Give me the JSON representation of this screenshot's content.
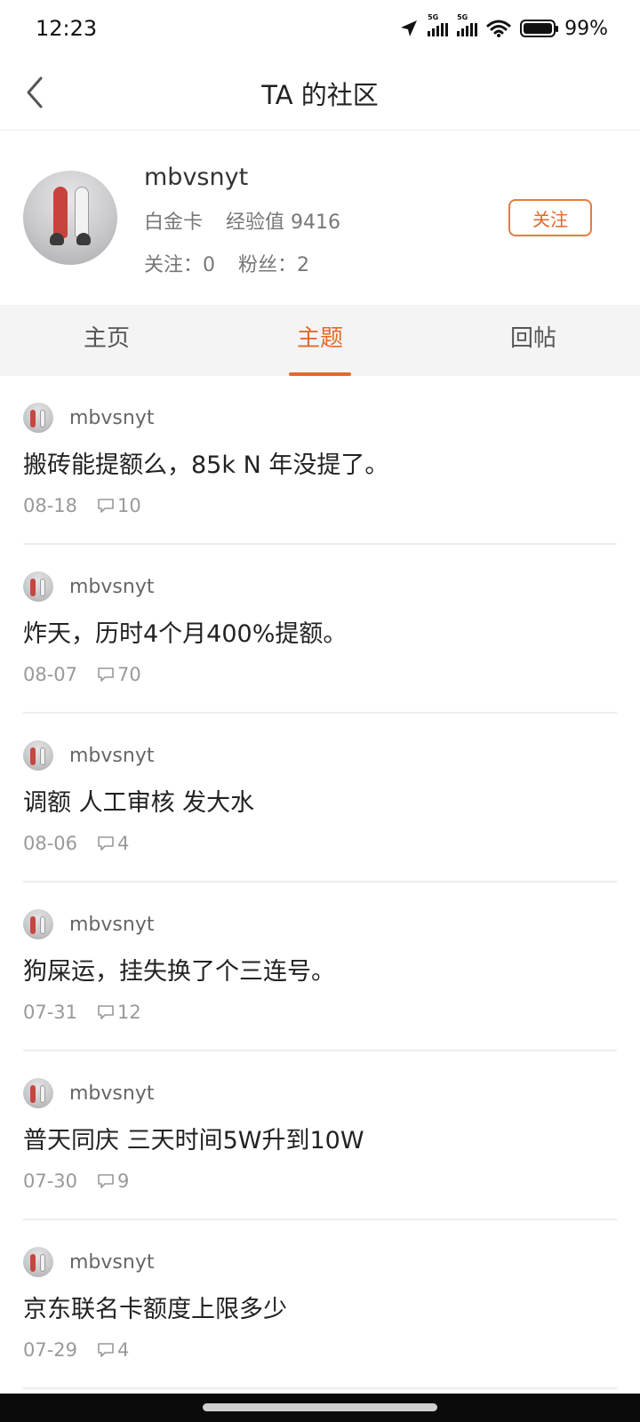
{
  "status": {
    "time": "12:23",
    "battery": "99%",
    "network1": "5G",
    "network2": "5G"
  },
  "nav": {
    "title": "TA 的社区"
  },
  "profile": {
    "username": "mbvsnyt",
    "card_level": "白金卡",
    "experience": "经验值 9416",
    "following": "关注：0",
    "followers": "粉丝：2",
    "follow_button": "关注"
  },
  "tabs": [
    {
      "label": "主页",
      "active": false
    },
    {
      "label": "主题",
      "active": true
    },
    {
      "label": "回帖",
      "active": false
    }
  ],
  "posts": [
    {
      "author": "mbvsnyt",
      "title": "搬砖能提额么，85k N 年没提了。",
      "date": "08-18",
      "comments": "10"
    },
    {
      "author": "mbvsnyt",
      "title": "炸天，历时4个月400%提额。",
      "date": "08-07",
      "comments": "70"
    },
    {
      "author": "mbvsnyt",
      "title": "调额 人工审核 发大水",
      "date": "08-06",
      "comments": "4"
    },
    {
      "author": "mbvsnyt",
      "title": "狗屎运，挂失换了个三连号。",
      "date": "07-31",
      "comments": "12"
    },
    {
      "author": "mbvsnyt",
      "title": "普天同庆 三天时间5W升到10W",
      "date": "07-30",
      "comments": "9"
    },
    {
      "author": "mbvsnyt",
      "title": "京东联名卡额度上限多少",
      "date": "07-29",
      "comments": "4"
    }
  ],
  "colors": {
    "accent": "#e26a2b",
    "divider": "#ededed",
    "tab_bg": "#f4f4f5"
  }
}
